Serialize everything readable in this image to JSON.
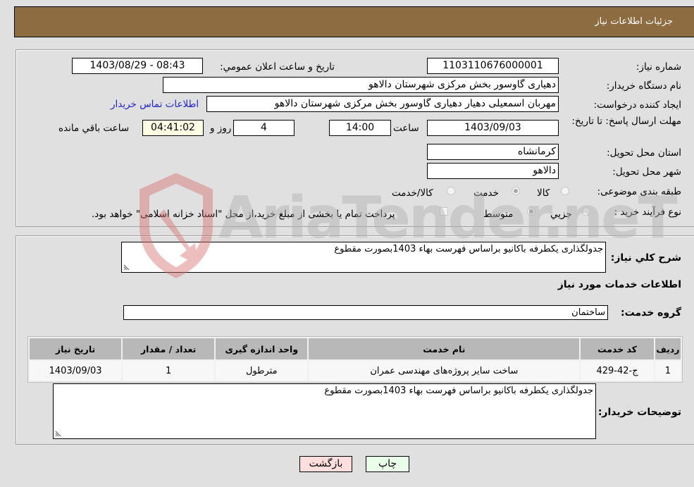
{
  "header": {
    "title": "جزئیات اطلاعات نیاز"
  },
  "details": {
    "need_number": {
      "label": "شماره نیاز:",
      "value": "1103110676000001"
    },
    "announce_datetime": {
      "label": "تاریخ و ساعت اعلان عمومي:",
      "value": "1403/08/29 - 08:43"
    },
    "buyer_org": {
      "label": "نام دستگاه خریدار:",
      "value": "دهیاری گاوسور بخش مرکزی شهرستان دالاهو"
    },
    "requester": {
      "label": "ایجاد کننده درخواست:",
      "value": "مهربان اسمعیلی دهیار دهیاری گاوسور بخش مرکزی شهرستان دالاهو"
    },
    "buyer_contact_link": "اطلاعات تماس خریدار",
    "deadline": {
      "label": "مهلت ارسال پاسخ: تا تاریخ:",
      "date": "1403/09/03",
      "time_label": "ساعت",
      "time": "14:00",
      "days": "4",
      "days_label": "روز و",
      "remaining": "04:41:02",
      "remaining_label": "ساعت باقي مانده"
    },
    "province": {
      "label": "استان محل تحویل:",
      "value": "کرمانشاه"
    },
    "city": {
      "label": "شهر محل تحویل:",
      "value": "دالاهو"
    },
    "category": {
      "label": "طبقه بندی موضوعی:",
      "options": [
        {
          "label": "کالا",
          "checked": false
        },
        {
          "label": "خدمت",
          "checked": true
        },
        {
          "label": "کالا/خدمت",
          "checked": false
        }
      ]
    },
    "purchase_type": {
      "label": "نوع فرآیند خرید :",
      "options": [
        {
          "label": "جزیي",
          "checked": false
        },
        {
          "label": "متوسط",
          "checked": true
        }
      ],
      "treasury_checkbox_label": "پرداخت تمام یا بخشی از مبلغ خرید،از محل \"اسناد خزانه اسلامی\" خواهد بود.",
      "treasury_checked": false
    }
  },
  "description": {
    "label": "شرح کلي نیاز:",
    "value": "جدولگذاری یکطرفه باکانیو براساس فهرست بهاء 1403بصورت مقطوع"
  },
  "services": {
    "section_title": "اطلاعات خدمات مورد نیاز",
    "group_label": "گروه خدمت:",
    "group_value": "ساختمان",
    "columns": [
      "ردیف",
      "کد خدمت",
      "نام خدمت",
      "واحد اندازه گیری",
      "تعداد / مقدار",
      "تاریخ نیاز"
    ],
    "rows": [
      [
        "1",
        "ج-42-429",
        "ساخت سایر پروژه‌های مهندسی عمران",
        "مترطول",
        "1",
        "1403/09/03"
      ]
    ]
  },
  "buyer_notes": {
    "label": "توضیحات خریدار:",
    "value": "جدولگذاری یکطرفه باکانیو براساس فهرست بهاء 1403بصورت مقطوع"
  },
  "buttons": {
    "print": "چاپ",
    "back": "بازگشت"
  },
  "watermark": {
    "text": "AriaTender.neT"
  },
  "colors": {
    "header": "#8e6c42",
    "print_bg": "#eaffea",
    "back_bg": "#ffdede",
    "link": "#2222cc"
  }
}
